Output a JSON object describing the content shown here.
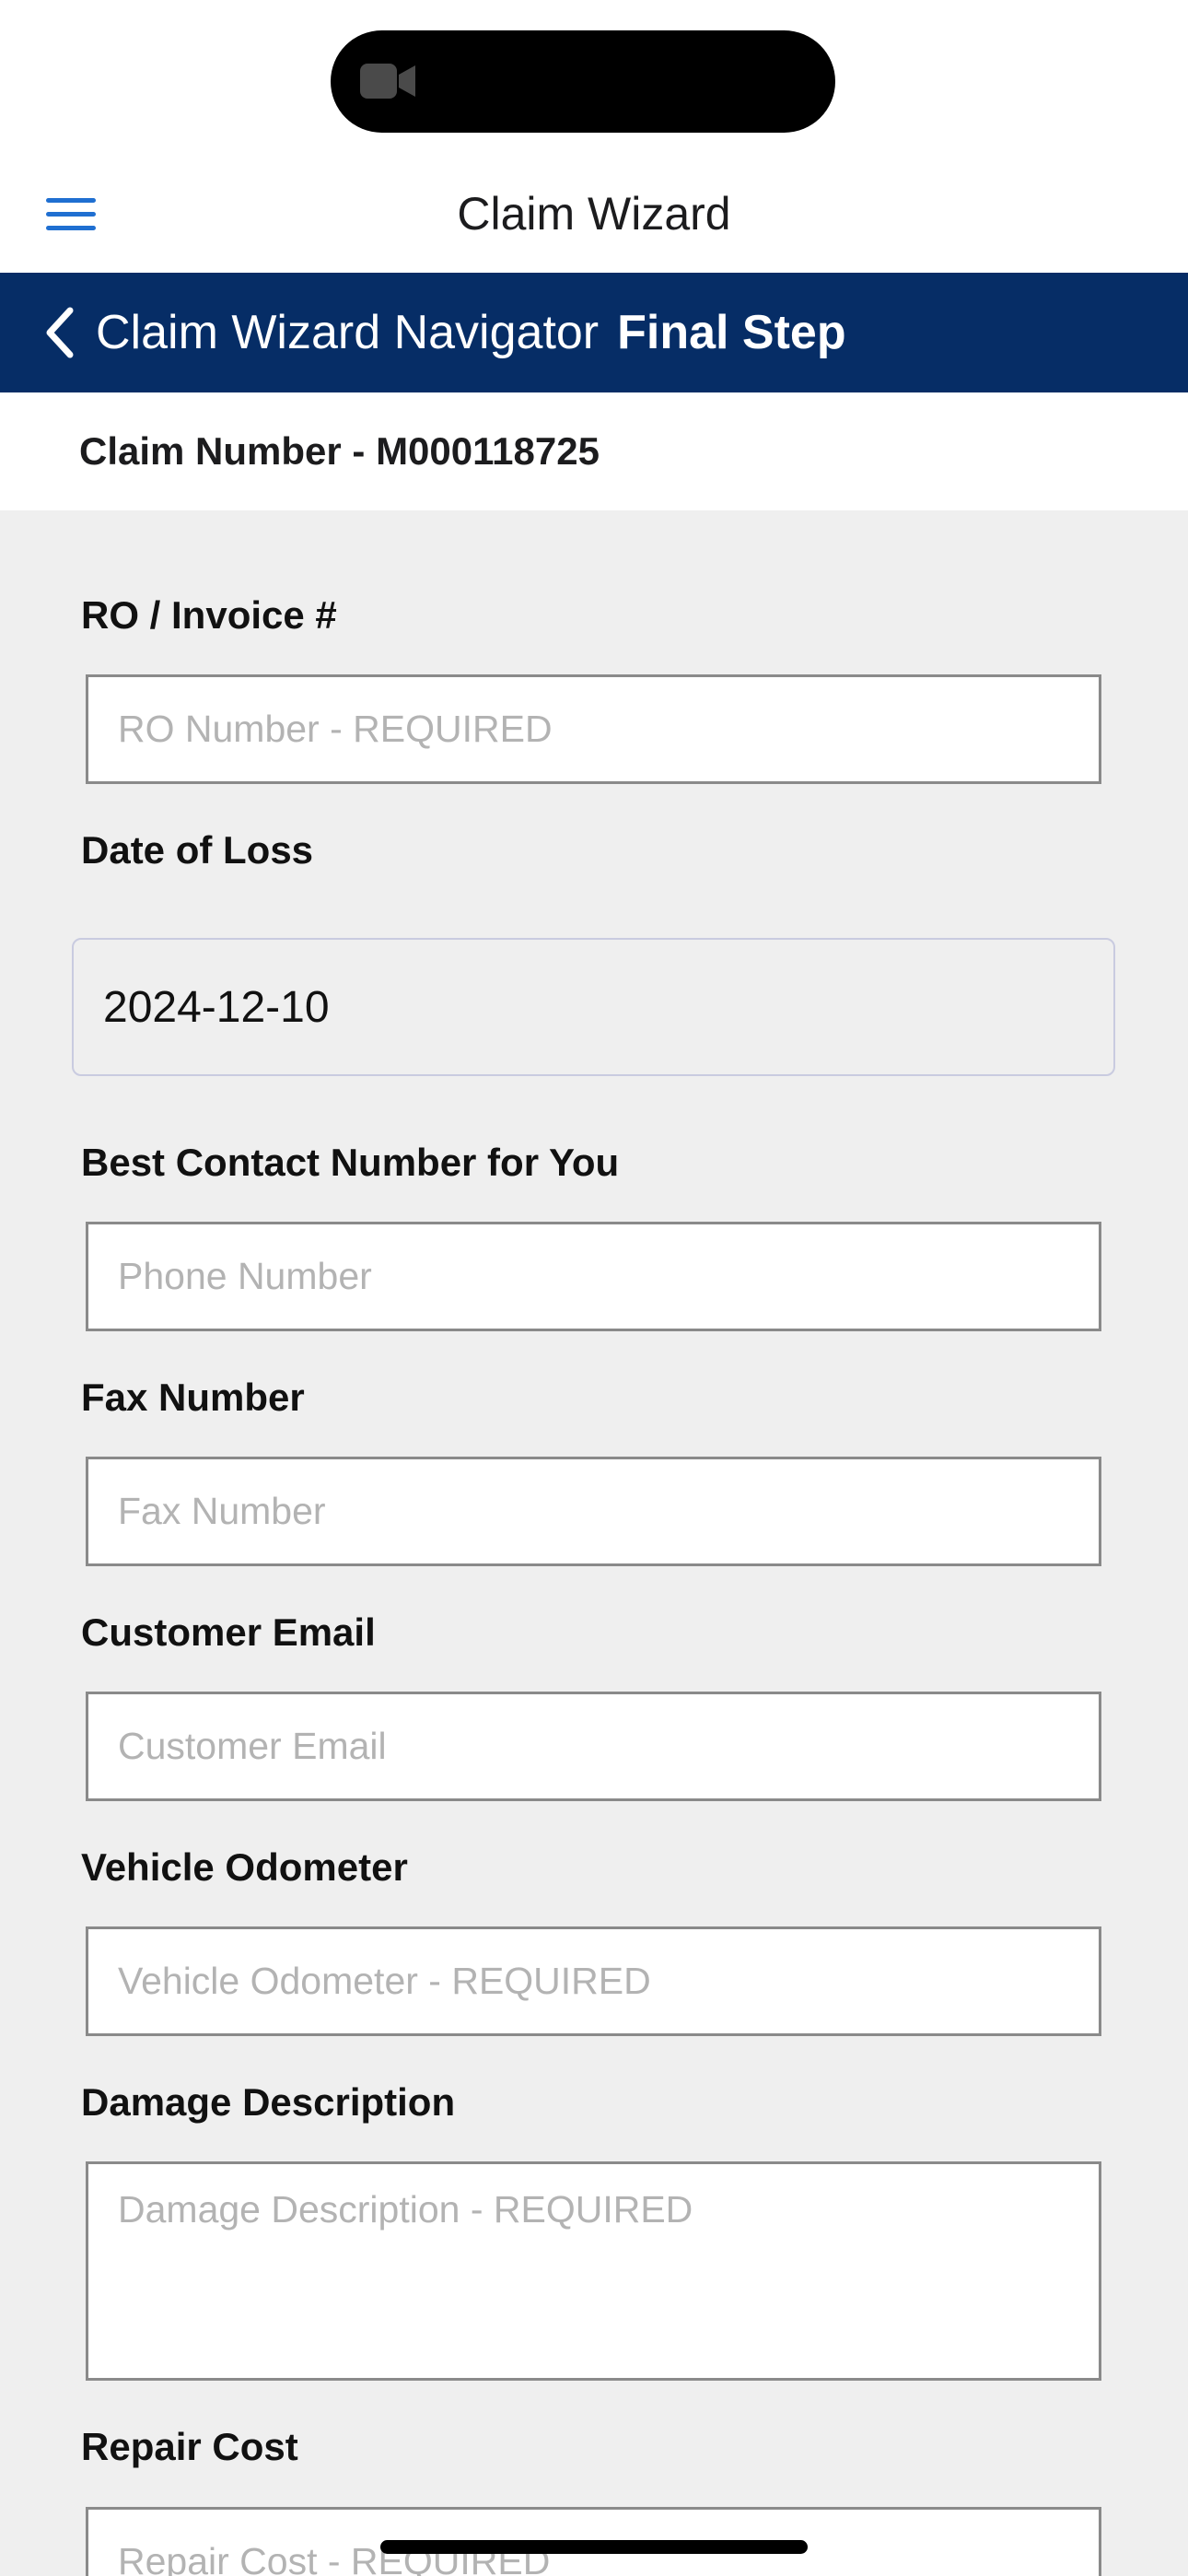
{
  "app": {
    "title": "Claim Wizard"
  },
  "navigator": {
    "label": "Claim Wizard Navigator",
    "step": "Final Step"
  },
  "claim": {
    "prefix": "Claim Number",
    "separator": " - ",
    "number": "M000118725"
  },
  "form": {
    "ro_invoice": {
      "label": "RO / Invoice #",
      "placeholder": "RO Number - REQUIRED"
    },
    "date_of_loss": {
      "label": "Date of Loss",
      "value": "2024-12-10"
    },
    "contact_number": {
      "label": "Best Contact Number for You",
      "placeholder": "Phone Number"
    },
    "fax_number": {
      "label": "Fax Number",
      "placeholder": "Fax Number"
    },
    "customer_email": {
      "label": "Customer Email",
      "placeholder": "Customer Email"
    },
    "vehicle_odometer": {
      "label": "Vehicle Odometer",
      "placeholder": "Vehicle Odometer - REQUIRED"
    },
    "damage_description": {
      "label": "Damage Description",
      "placeholder": "Damage Description - REQUIRED"
    },
    "repair_cost": {
      "label": "Repair Cost",
      "placeholder": "Repair Cost - REQUIRED"
    }
  },
  "icons": {
    "menu": "hamburger-menu-icon",
    "back": "chevron-left-icon",
    "camera": "video-camera-icon"
  },
  "colors": {
    "nav_bar": "#062d66",
    "menu_accent": "#1f6fd1",
    "form_background": "#efefef"
  }
}
